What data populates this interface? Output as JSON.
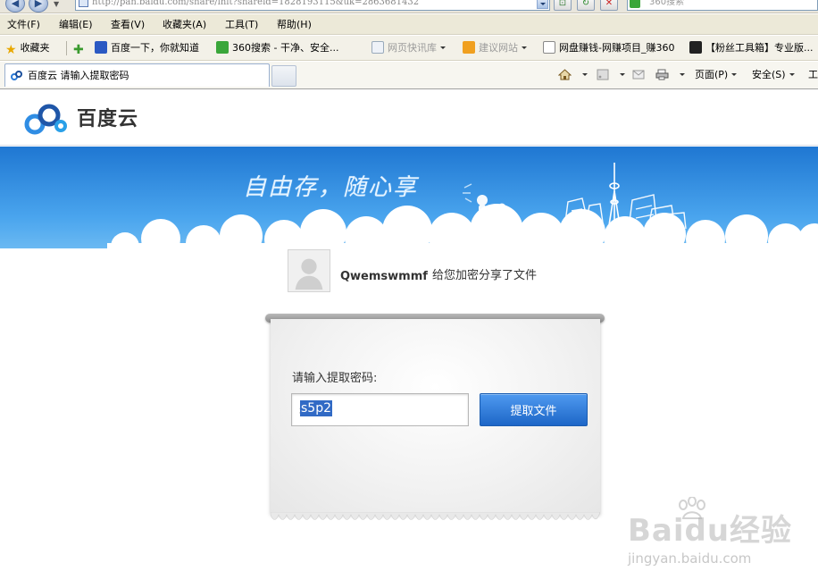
{
  "browser": {
    "url": "http://pan.baidu.com/share/init?shareid=1828193115&uk=2863681432",
    "search_placeholder": "360搜索",
    "menu": [
      "文件(F)",
      "编辑(E)",
      "查看(V)",
      "收藏夹(A)",
      "工具(T)",
      "帮助(H)"
    ],
    "favorites": {
      "label": "收藏夹",
      "items": [
        "百度一下，你就知道",
        "360搜索 - 干净、安全...",
        "网页快讯库",
        "建议网站",
        "网盘赚钱-网赚项目_赚360",
        "【粉丝工具箱】专业版..."
      ]
    },
    "tab_title": "百度云 请输入提取密码",
    "commands": {
      "page": "页面(P)",
      "safety": "安全(S)",
      "tools": "工"
    }
  },
  "site": {
    "logo_text": "百度云",
    "slogan": "自由存，随心享"
  },
  "share": {
    "user_name": "Qwemswmmf",
    "message": "给您加密分享了文件",
    "password_label": "请输入提取密码:",
    "password_value": "s5p2",
    "submit_label": "提取文件"
  },
  "watermark": {
    "brand": "Baidu经验",
    "url": "jingyan.baidu.com"
  },
  "colors": {
    "banner": "#2a85dc",
    "button": "#2673d6",
    "selection": "#316ac5"
  }
}
